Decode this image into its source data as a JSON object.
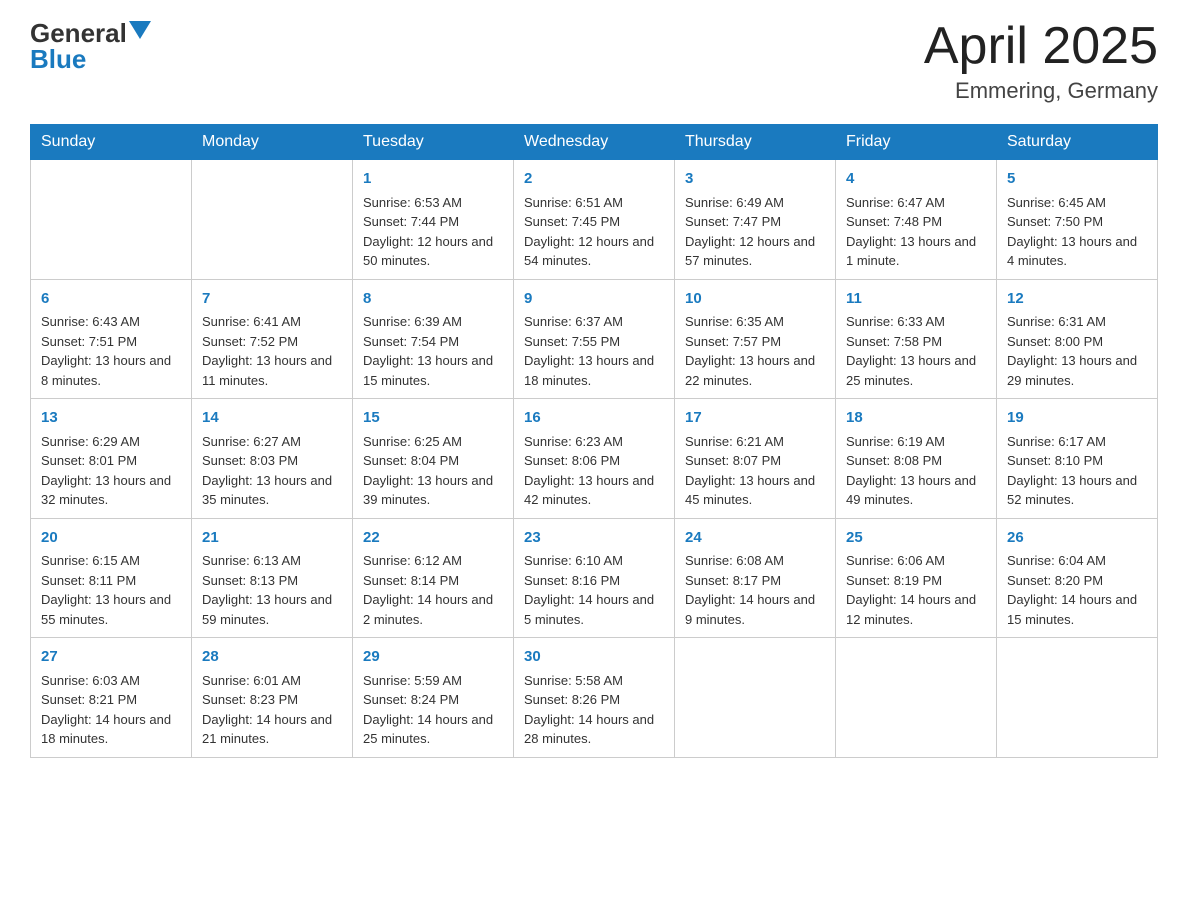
{
  "header": {
    "title": "April 2025",
    "subtitle": "Emmering, Germany",
    "logo_general": "General",
    "logo_blue": "Blue"
  },
  "days_of_week": [
    "Sunday",
    "Monday",
    "Tuesday",
    "Wednesday",
    "Thursday",
    "Friday",
    "Saturday"
  ],
  "weeks": [
    [
      {
        "day": "",
        "sunrise": "",
        "sunset": "",
        "daylight": ""
      },
      {
        "day": "",
        "sunrise": "",
        "sunset": "",
        "daylight": ""
      },
      {
        "day": "1",
        "sunrise": "Sunrise: 6:53 AM",
        "sunset": "Sunset: 7:44 PM",
        "daylight": "Daylight: 12 hours and 50 minutes."
      },
      {
        "day": "2",
        "sunrise": "Sunrise: 6:51 AM",
        "sunset": "Sunset: 7:45 PM",
        "daylight": "Daylight: 12 hours and 54 minutes."
      },
      {
        "day": "3",
        "sunrise": "Sunrise: 6:49 AM",
        "sunset": "Sunset: 7:47 PM",
        "daylight": "Daylight: 12 hours and 57 minutes."
      },
      {
        "day": "4",
        "sunrise": "Sunrise: 6:47 AM",
        "sunset": "Sunset: 7:48 PM",
        "daylight": "Daylight: 13 hours and 1 minute."
      },
      {
        "day": "5",
        "sunrise": "Sunrise: 6:45 AM",
        "sunset": "Sunset: 7:50 PM",
        "daylight": "Daylight: 13 hours and 4 minutes."
      }
    ],
    [
      {
        "day": "6",
        "sunrise": "Sunrise: 6:43 AM",
        "sunset": "Sunset: 7:51 PM",
        "daylight": "Daylight: 13 hours and 8 minutes."
      },
      {
        "day": "7",
        "sunrise": "Sunrise: 6:41 AM",
        "sunset": "Sunset: 7:52 PM",
        "daylight": "Daylight: 13 hours and 11 minutes."
      },
      {
        "day": "8",
        "sunrise": "Sunrise: 6:39 AM",
        "sunset": "Sunset: 7:54 PM",
        "daylight": "Daylight: 13 hours and 15 minutes."
      },
      {
        "day": "9",
        "sunrise": "Sunrise: 6:37 AM",
        "sunset": "Sunset: 7:55 PM",
        "daylight": "Daylight: 13 hours and 18 minutes."
      },
      {
        "day": "10",
        "sunrise": "Sunrise: 6:35 AM",
        "sunset": "Sunset: 7:57 PM",
        "daylight": "Daylight: 13 hours and 22 minutes."
      },
      {
        "day": "11",
        "sunrise": "Sunrise: 6:33 AM",
        "sunset": "Sunset: 7:58 PM",
        "daylight": "Daylight: 13 hours and 25 minutes."
      },
      {
        "day": "12",
        "sunrise": "Sunrise: 6:31 AM",
        "sunset": "Sunset: 8:00 PM",
        "daylight": "Daylight: 13 hours and 29 minutes."
      }
    ],
    [
      {
        "day": "13",
        "sunrise": "Sunrise: 6:29 AM",
        "sunset": "Sunset: 8:01 PM",
        "daylight": "Daylight: 13 hours and 32 minutes."
      },
      {
        "day": "14",
        "sunrise": "Sunrise: 6:27 AM",
        "sunset": "Sunset: 8:03 PM",
        "daylight": "Daylight: 13 hours and 35 minutes."
      },
      {
        "day": "15",
        "sunrise": "Sunrise: 6:25 AM",
        "sunset": "Sunset: 8:04 PM",
        "daylight": "Daylight: 13 hours and 39 minutes."
      },
      {
        "day": "16",
        "sunrise": "Sunrise: 6:23 AM",
        "sunset": "Sunset: 8:06 PM",
        "daylight": "Daylight: 13 hours and 42 minutes."
      },
      {
        "day": "17",
        "sunrise": "Sunrise: 6:21 AM",
        "sunset": "Sunset: 8:07 PM",
        "daylight": "Daylight: 13 hours and 45 minutes."
      },
      {
        "day": "18",
        "sunrise": "Sunrise: 6:19 AM",
        "sunset": "Sunset: 8:08 PM",
        "daylight": "Daylight: 13 hours and 49 minutes."
      },
      {
        "day": "19",
        "sunrise": "Sunrise: 6:17 AM",
        "sunset": "Sunset: 8:10 PM",
        "daylight": "Daylight: 13 hours and 52 minutes."
      }
    ],
    [
      {
        "day": "20",
        "sunrise": "Sunrise: 6:15 AM",
        "sunset": "Sunset: 8:11 PM",
        "daylight": "Daylight: 13 hours and 55 minutes."
      },
      {
        "day": "21",
        "sunrise": "Sunrise: 6:13 AM",
        "sunset": "Sunset: 8:13 PM",
        "daylight": "Daylight: 13 hours and 59 minutes."
      },
      {
        "day": "22",
        "sunrise": "Sunrise: 6:12 AM",
        "sunset": "Sunset: 8:14 PM",
        "daylight": "Daylight: 14 hours and 2 minutes."
      },
      {
        "day": "23",
        "sunrise": "Sunrise: 6:10 AM",
        "sunset": "Sunset: 8:16 PM",
        "daylight": "Daylight: 14 hours and 5 minutes."
      },
      {
        "day": "24",
        "sunrise": "Sunrise: 6:08 AM",
        "sunset": "Sunset: 8:17 PM",
        "daylight": "Daylight: 14 hours and 9 minutes."
      },
      {
        "day": "25",
        "sunrise": "Sunrise: 6:06 AM",
        "sunset": "Sunset: 8:19 PM",
        "daylight": "Daylight: 14 hours and 12 minutes."
      },
      {
        "day": "26",
        "sunrise": "Sunrise: 6:04 AM",
        "sunset": "Sunset: 8:20 PM",
        "daylight": "Daylight: 14 hours and 15 minutes."
      }
    ],
    [
      {
        "day": "27",
        "sunrise": "Sunrise: 6:03 AM",
        "sunset": "Sunset: 8:21 PM",
        "daylight": "Daylight: 14 hours and 18 minutes."
      },
      {
        "day": "28",
        "sunrise": "Sunrise: 6:01 AM",
        "sunset": "Sunset: 8:23 PM",
        "daylight": "Daylight: 14 hours and 21 minutes."
      },
      {
        "day": "29",
        "sunrise": "Sunrise: 5:59 AM",
        "sunset": "Sunset: 8:24 PM",
        "daylight": "Daylight: 14 hours and 25 minutes."
      },
      {
        "day": "30",
        "sunrise": "Sunrise: 5:58 AM",
        "sunset": "Sunset: 8:26 PM",
        "daylight": "Daylight: 14 hours and 28 minutes."
      },
      {
        "day": "",
        "sunrise": "",
        "sunset": "",
        "daylight": ""
      },
      {
        "day": "",
        "sunrise": "",
        "sunset": "",
        "daylight": ""
      },
      {
        "day": "",
        "sunrise": "",
        "sunset": "",
        "daylight": ""
      }
    ]
  ]
}
